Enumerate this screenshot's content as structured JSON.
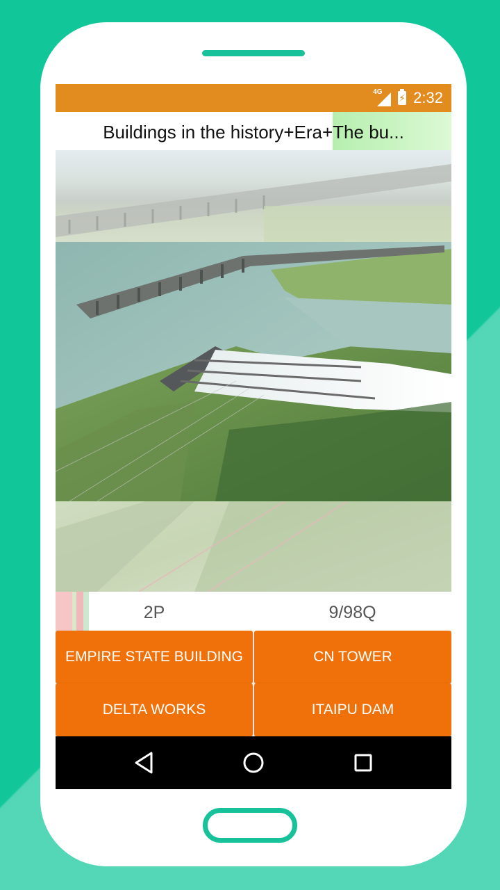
{
  "status_bar": {
    "network": "4G",
    "time": "2:32",
    "color": "#e28c20"
  },
  "header": {
    "title": "Buildings in the history+Era+The bu..."
  },
  "question_image": {
    "icon": "dam-photo",
    "description_hidden": true
  },
  "score": {
    "points": "2P",
    "progress": "9/98Q"
  },
  "answers": [
    {
      "label": "EMPIRE STATE BUILDING"
    },
    {
      "label": "CN TOWER"
    },
    {
      "label": "DELTA WORKS"
    },
    {
      "label": "ITAIPU DAM"
    }
  ],
  "colors": {
    "background": "#11c79a",
    "answer_button": "#f07109",
    "accent": "#17c29a"
  },
  "nav": {
    "back_icon": "back-triangle-icon",
    "home_icon": "home-circle-icon",
    "recent_icon": "recent-square-icon"
  }
}
